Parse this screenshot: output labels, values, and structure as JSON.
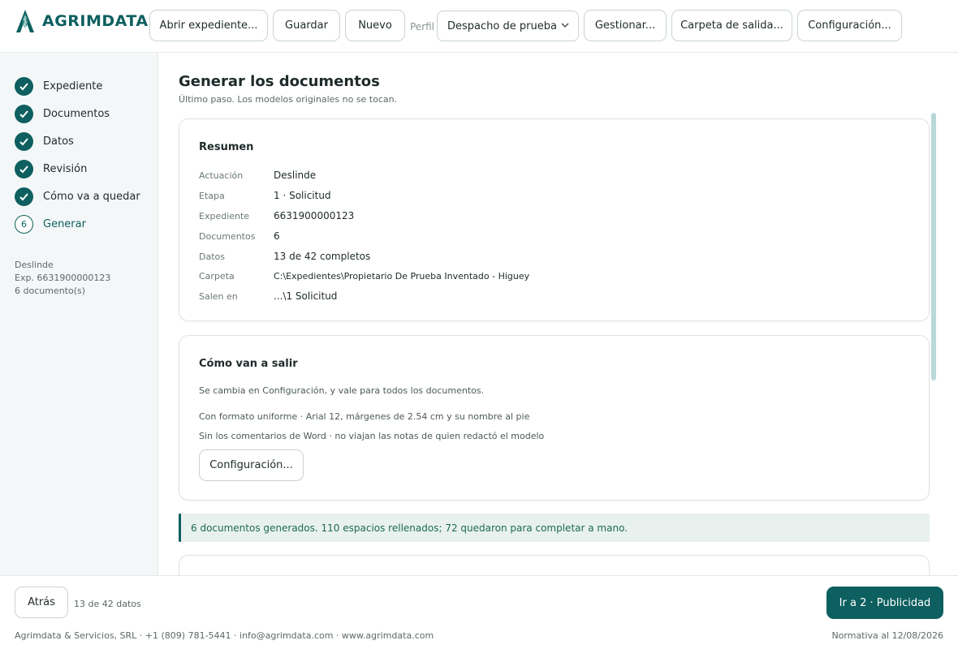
{
  "brand": {
    "name": "AGRIMDATA"
  },
  "toolbar": {
    "open_label": "Abrir expediente...",
    "save_label": "Guardar",
    "new_label": "Nuevo",
    "perfil_label": "Perfil",
    "perfil_value": "Despacho de prueba",
    "manage_label": "Gestionar...",
    "output_folder_label": "Carpeta de salida...",
    "config_label": "Configuración..."
  },
  "steps": [
    {
      "label": "Expediente",
      "state": "done"
    },
    {
      "label": "Documentos",
      "state": "done"
    },
    {
      "label": "Datos",
      "state": "done"
    },
    {
      "label": "Revisión",
      "state": "done"
    },
    {
      "label": "Cómo va a quedar",
      "state": "done"
    },
    {
      "label": "Generar",
      "state": "current",
      "number": "6"
    }
  ],
  "side_info": {
    "line1": "Deslinde",
    "line2": "Exp. 6631900000123",
    "line3": "6 documento(s)"
  },
  "main": {
    "title": "Generar los documentos",
    "subtitle": "Último paso. Los modelos originales no se tocan."
  },
  "summary": {
    "title": "Resumen",
    "rows": [
      {
        "key": "Actuación",
        "value": "Deslinde"
      },
      {
        "key": "Etapa",
        "value": "1 · Solicitud"
      },
      {
        "key": "Expediente",
        "value": "6631900000123"
      },
      {
        "key": "Documentos",
        "value": "6"
      },
      {
        "key": "Datos",
        "value": "13 de 42 completos"
      },
      {
        "key": "Carpeta",
        "value": "C:\\Expedientes\\Propietario De Prueba Inventado - Higuey"
      },
      {
        "key": "Salen en",
        "value": "...\\1 Solicitud"
      }
    ]
  },
  "output": {
    "title": "Cómo van a salir",
    "note": "Se cambia en Configuración, y vale para todos los documentos.",
    "line1": "Con formato uniforme · Arial 12, márgenes de 2.54 cm y su nombre al pie",
    "line2": "Sin los comentarios de Word · no viajan las notas de quien redactó el modelo",
    "config_button": "Configuración..."
  },
  "banner": {
    "text": "6 documentos generados. 110 espacios rellenados; 72 quedaron para completar a mano."
  },
  "footer": {
    "back_label": "Atrás",
    "count": "13 de 42 datos",
    "next_label": "Ir a 2 · Publicidad",
    "contact": "Agrimdata & Servicios, SRL · +1 (809) 781-5441 · info@agrimdata.com · www.agrimdata.com",
    "normativa": "Normativa al 12/08/2026"
  },
  "colors": {
    "brand": "#0e5f5f",
    "success_text": "#1d6b4e",
    "success_bg": "#e8f1ee"
  }
}
